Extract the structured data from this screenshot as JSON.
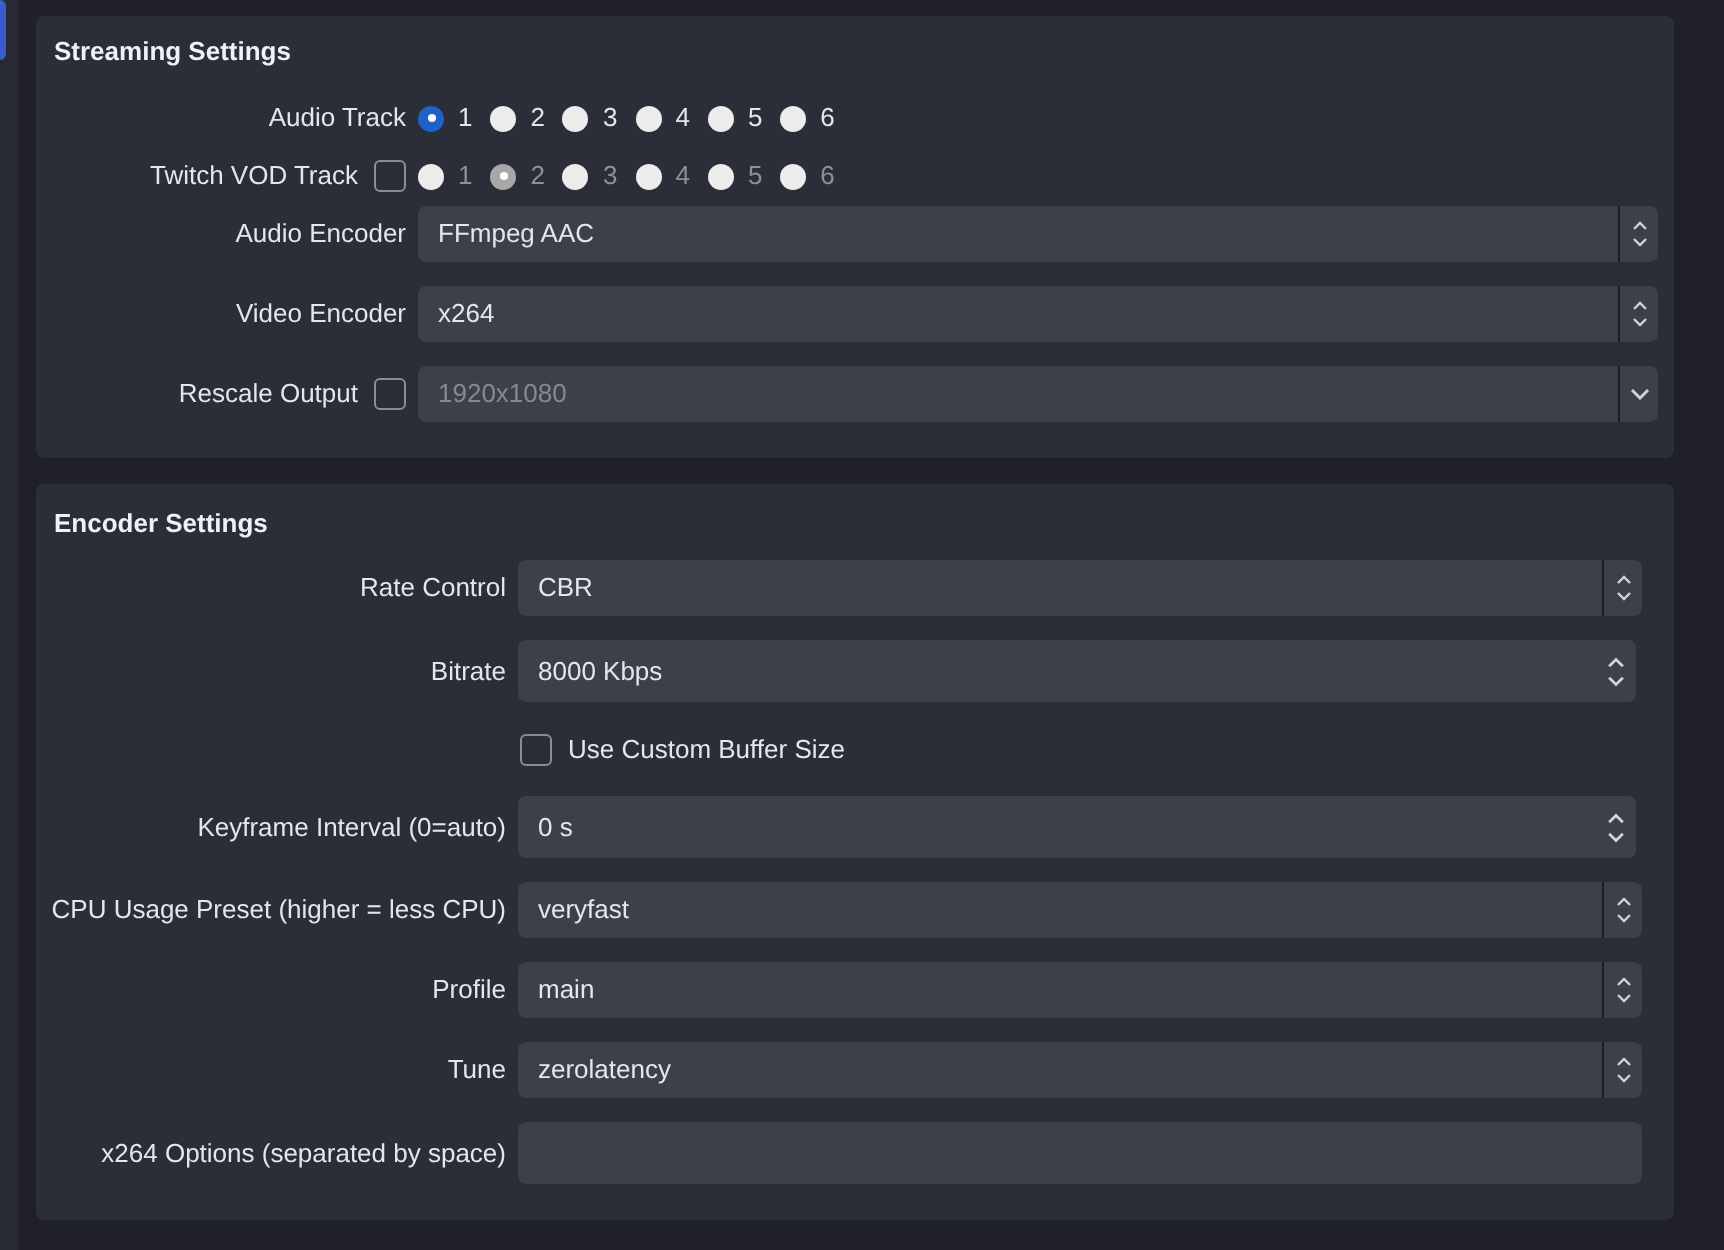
{
  "streaming_settings": {
    "title": "Streaming Settings",
    "rows": [
      {
        "kind": "radios",
        "label": "Audio Track",
        "disabled": false,
        "options": [
          {
            "label": "1",
            "selected": true
          },
          {
            "label": "2",
            "selected": false
          },
          {
            "label": "3",
            "selected": false
          },
          {
            "label": "4",
            "selected": false
          },
          {
            "label": "5",
            "selected": false
          },
          {
            "label": "6",
            "selected": false
          }
        ]
      },
      {
        "kind": "radios",
        "label": "Twitch VOD Track",
        "checkbox": {
          "checked": false
        },
        "disabled": true,
        "options": [
          {
            "label": "1",
            "selected": false
          },
          {
            "label": "2",
            "selected": true
          },
          {
            "label": "3",
            "selected": false
          },
          {
            "label": "4",
            "selected": false
          },
          {
            "label": "5",
            "selected": false
          },
          {
            "label": "6",
            "selected": false
          }
        ]
      },
      {
        "kind": "combo",
        "label": "Audio Encoder",
        "value": "FFmpeg AAC",
        "disabled": false
      },
      {
        "kind": "combo",
        "label": "Video Encoder",
        "value": "x264",
        "disabled": false
      },
      {
        "kind": "dropdown",
        "label": "Rescale Output",
        "checkbox": {
          "checked": false
        },
        "value": "1920x1080",
        "disabled": true
      }
    ]
  },
  "encoder_settings": {
    "title": "Encoder Settings",
    "rows": [
      {
        "kind": "combo",
        "label": "Rate Control",
        "value": "CBR",
        "disabled": false
      },
      {
        "kind": "spin",
        "label": "Bitrate",
        "value": "8000 Kbps"
      },
      {
        "kind": "checkbox",
        "label": "Use Custom Buffer Size",
        "checked": false
      },
      {
        "kind": "spin",
        "label": "Keyframe Interval (0=auto)",
        "value": "0 s"
      },
      {
        "kind": "combo",
        "label": "CPU Usage Preset (higher = less CPU)",
        "value": "veryfast",
        "disabled": false
      },
      {
        "kind": "combo",
        "label": "Profile",
        "value": "main",
        "disabled": false
      },
      {
        "kind": "combo",
        "label": "Tune",
        "value": "zerolatency",
        "disabled": false
      },
      {
        "kind": "text",
        "label": "x264 Options (separated by space)"
      }
    ]
  }
}
